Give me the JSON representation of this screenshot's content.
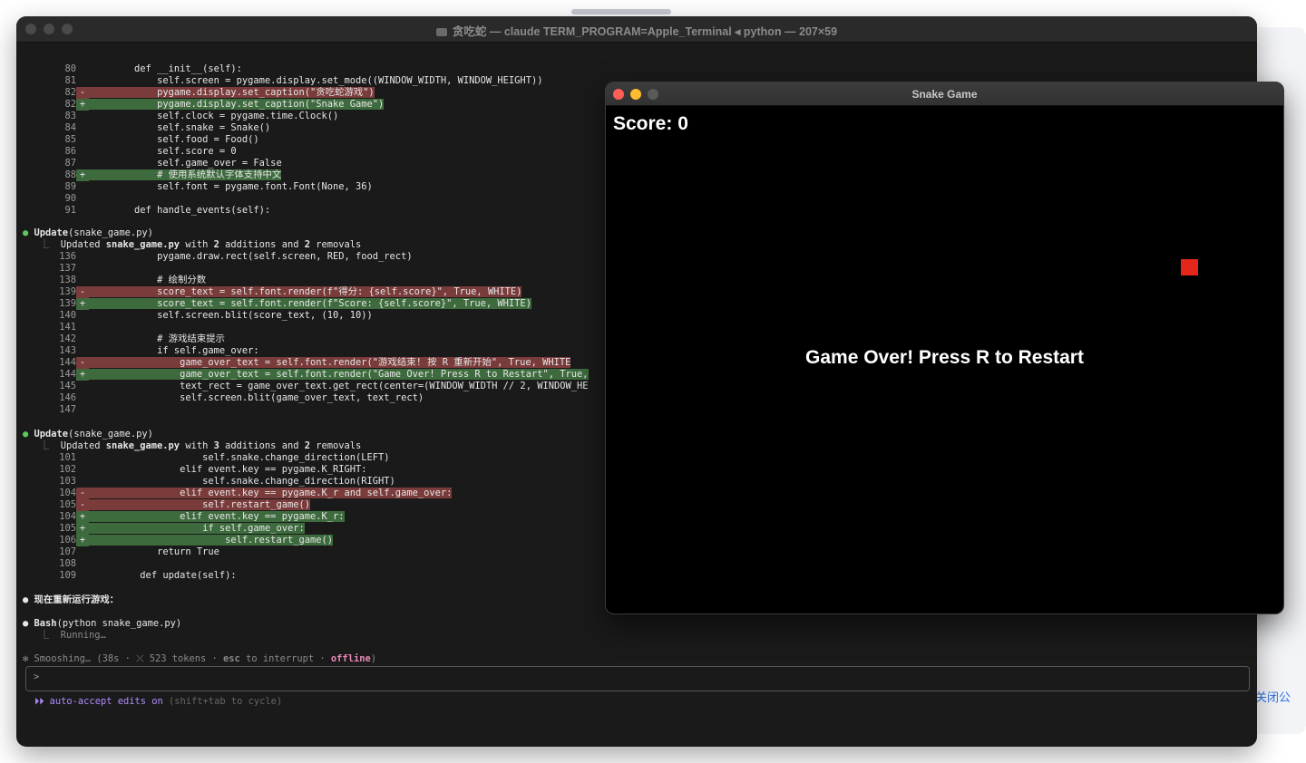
{
  "terminal": {
    "title": "贪吃蛇 — claude TERM_PROGRAM=Apple_Terminal ◂ python — 207×59",
    "diff1": [
      {
        "n": "80",
        "s": "",
        "t": "        def __init__(self):"
      },
      {
        "n": "81",
        "s": "",
        "t": "            self.screen = pygame.display.set_mode((WINDOW_WIDTH, WINDOW_HEIGHT))"
      },
      {
        "n": "82",
        "s": "-",
        "t": "            pygame.display.set_caption(\"贪吃蛇游戏\")",
        "k": "rem"
      },
      {
        "n": "82",
        "s": "+",
        "t": "            pygame.display.set_caption(\"Snake Game\")",
        "k": "add"
      },
      {
        "n": "83",
        "s": "",
        "t": "            self.clock = pygame.time.Clock()"
      },
      {
        "n": "84",
        "s": "",
        "t": "            self.snake = Snake()"
      },
      {
        "n": "85",
        "s": "",
        "t": "            self.food = Food()"
      },
      {
        "n": "86",
        "s": "",
        "t": "            self.score = 0"
      },
      {
        "n": "87",
        "s": "",
        "t": "            self.game_over = False"
      },
      {
        "n": "88",
        "s": "+",
        "t": "            # 使用系统默认字体支持中文",
        "k": "add"
      },
      {
        "n": "89",
        "s": "",
        "t": "            self.font = pygame.font.Font(None, 36)"
      },
      {
        "n": "90",
        "s": "",
        "t": ""
      },
      {
        "n": "91",
        "s": "",
        "t": "        def handle_events(self):"
      }
    ],
    "update1": {
      "label": "Update",
      "file": "(snake_game.py)",
      "summary_pre": "Updated ",
      "summary_file": "snake_game.py",
      "summary_with": " with ",
      "adds": "2",
      "adds_word": " additions and ",
      "rems": "2",
      "rems_word": " removals"
    },
    "diff2": [
      {
        "n": "136",
        "s": "",
        "t": "            pygame.draw.rect(self.screen, RED, food_rect)"
      },
      {
        "n": "137",
        "s": "",
        "t": ""
      },
      {
        "n": "138",
        "s": "",
        "t": "            # 绘制分数"
      },
      {
        "n": "139",
        "s": "-",
        "t": "            score_text = self.font.render(f\"得分: {self.score}\", True, WHITE)",
        "k": "rem"
      },
      {
        "n": "139",
        "s": "+",
        "t": "            score_text = self.font.render(f\"Score: {self.score}\", True, WHITE)",
        "k": "add"
      },
      {
        "n": "140",
        "s": "",
        "t": "            self.screen.blit(score_text, (10, 10))"
      },
      {
        "n": "141",
        "s": "",
        "t": ""
      },
      {
        "n": "142",
        "s": "",
        "t": "            # 游戏结束提示"
      },
      {
        "n": "143",
        "s": "",
        "t": "            if self.game_over:"
      },
      {
        "n": "144",
        "s": "-",
        "t": "                game_over_text = self.font.render(\"游戏结束! 按 R 重新开始\", True, WHITE",
        "k": "rem"
      },
      {
        "n": "144",
        "s": "+",
        "t": "                game_over_text = self.font.render(\"Game Over! Press R to Restart\", True,",
        "k": "add"
      },
      {
        "n": "145",
        "s": "",
        "t": "                text_rect = game_over_text.get_rect(center=(WINDOW_WIDTH // 2, WINDOW_HE"
      },
      {
        "n": "146",
        "s": "",
        "t": "                self.screen.blit(game_over_text, text_rect)"
      },
      {
        "n": "147",
        "s": "",
        "t": ""
      }
    ],
    "update2": {
      "label": "Update",
      "file": "(snake_game.py)",
      "summary_pre": "Updated ",
      "summary_file": "snake_game.py",
      "summary_with": " with ",
      "adds": "3",
      "adds_word": " additions and ",
      "rems": "2",
      "rems_word": " removals"
    },
    "diff3": [
      {
        "n": "101",
        "s": "",
        "t": "                    self.snake.change_direction(LEFT)"
      },
      {
        "n": "102",
        "s": "",
        "t": "                elif event.key == pygame.K_RIGHT:"
      },
      {
        "n": "103",
        "s": "",
        "t": "                    self.snake.change_direction(RIGHT)"
      },
      {
        "n": "104",
        "s": "-",
        "t": "                elif event.key == pygame.K_r and self.game_over:",
        "k": "rem"
      },
      {
        "n": "105",
        "s": "-",
        "t": "                    self.restart_game()",
        "k": "rem"
      },
      {
        "n": "104",
        "s": "+",
        "t": "                elif event.key == pygame.K_r:",
        "k": "add"
      },
      {
        "n": "105",
        "s": "+",
        "t": "                    if self.game_over:",
        "k": "add"
      },
      {
        "n": "106",
        "s": "+",
        "t": "                        self.restart_game()",
        "k": "add"
      },
      {
        "n": "107",
        "s": "",
        "t": "            return True"
      },
      {
        "n": "108",
        "s": "",
        "t": ""
      },
      {
        "n": "109",
        "s": "",
        "t": "         def update(self):"
      }
    ],
    "rerun_text": "现在重新运行游戏：",
    "bash_label": "Bash",
    "bash_cmd": "(python snake_game.py)",
    "running": "Running…",
    "status_pre": "Smooshing… (38s · ",
    "status_tokens": "⤫ 523 tokens · ",
    "status_esc": "esc",
    "status_mid": " to interrupt · ",
    "status_offline": "offline",
    "status_end": ")",
    "prompt": ">",
    "accept_label": "⏵⏵ auto-accept edits on",
    "accept_hint": " (shift+tab to cycle)"
  },
  "snake_window": {
    "title": "Snake Game",
    "score_label": "Score: 0",
    "game_over": "Game Over! Press R to Restart",
    "food_color": "#e5261b"
  },
  "background": {
    "link_text": "关闭公"
  },
  "colors": {
    "close": "#ff5f57",
    "minimize": "#febc2e",
    "zoom": "#5a5a5a"
  }
}
